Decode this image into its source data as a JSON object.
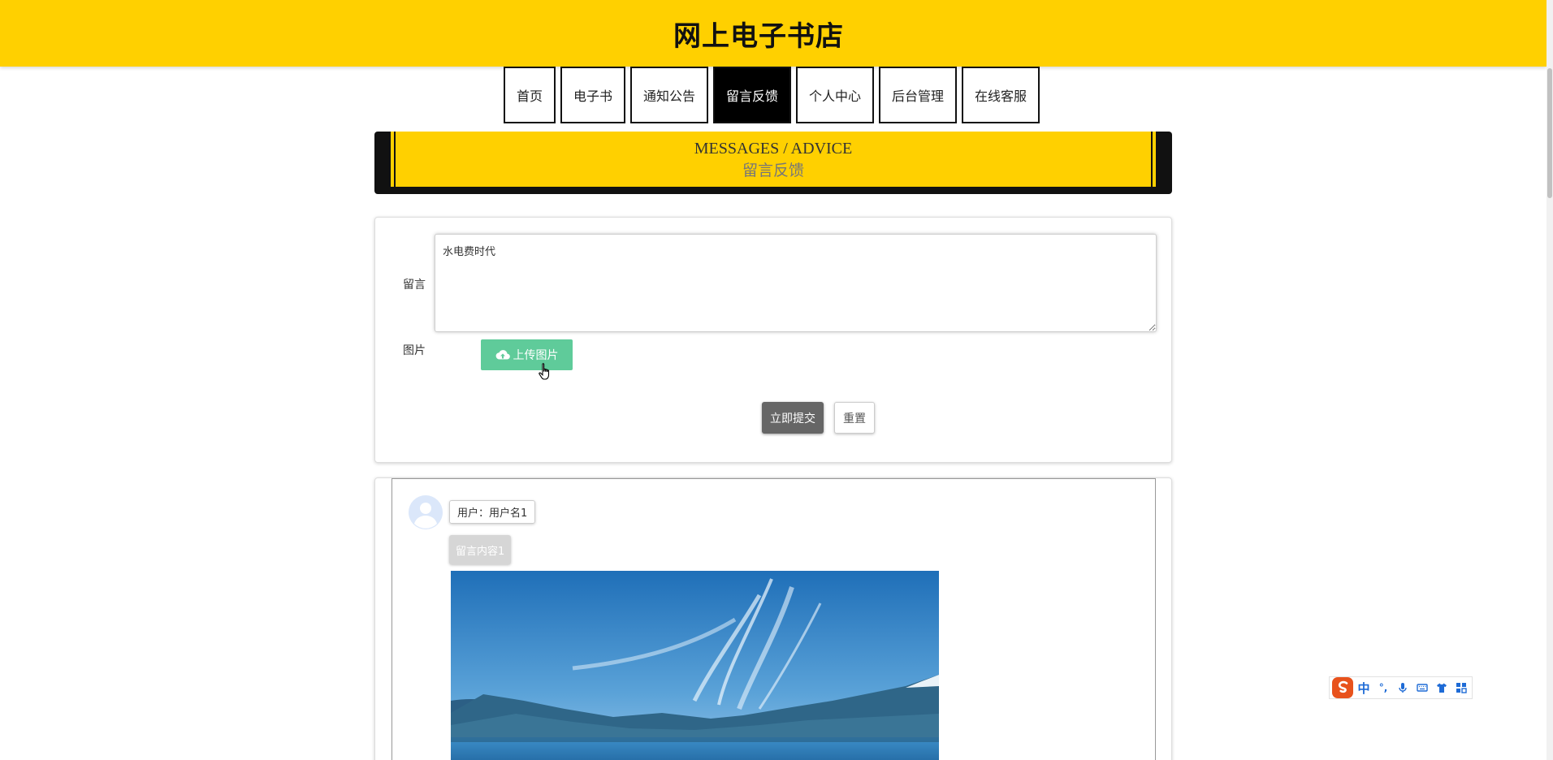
{
  "header": {
    "title": "网上电子书店"
  },
  "nav": {
    "items": [
      {
        "label": "首页"
      },
      {
        "label": "电子书"
      },
      {
        "label": "通知公告"
      },
      {
        "label": "留言反馈"
      },
      {
        "label": "个人中心"
      },
      {
        "label": "后台管理"
      },
      {
        "label": "在线客服"
      }
    ],
    "active": "留言反馈"
  },
  "banner": {
    "title_en": "MESSAGES / ADVICE",
    "title_cn": "留言反馈"
  },
  "form": {
    "message_label": "留言",
    "message_value": "水电费时代",
    "image_label": "图片",
    "upload_label": "上传图片",
    "submit_label": "立即提交",
    "reset_label": "重置"
  },
  "messages": [
    {
      "user": "用户：用户名1",
      "content": "留言内容1"
    }
  ],
  "ime": {
    "mode": "中",
    "punct": "°,"
  },
  "colors": {
    "brand": "#ffd000",
    "upload": "#5fcb9a",
    "submit": "#666666"
  }
}
